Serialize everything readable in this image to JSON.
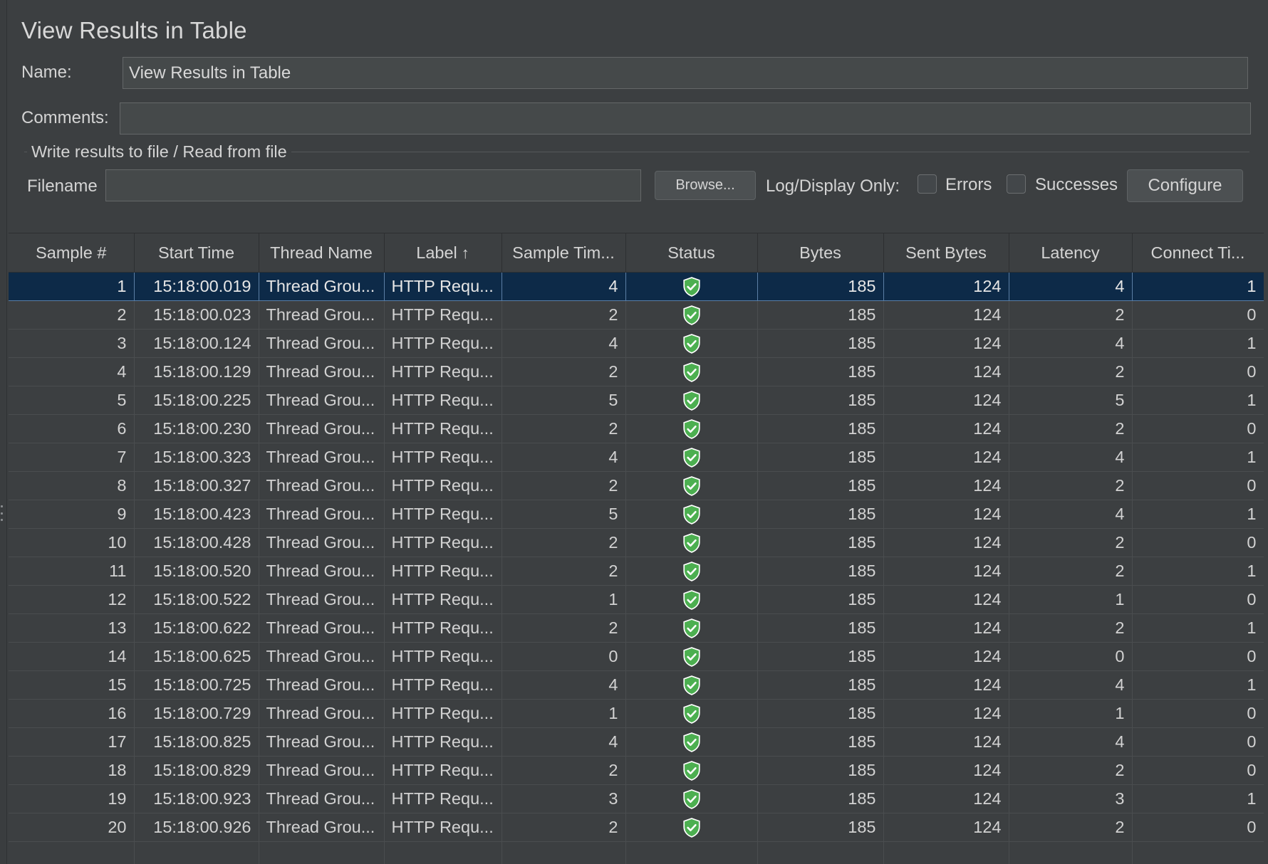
{
  "panel": {
    "title": "View Results in Table",
    "name_label": "Name:",
    "name_value": "View Results in Table",
    "comments_label": "Comments:",
    "comments_value": ""
  },
  "file_section": {
    "title": "Write results to file / Read from file",
    "filename_label": "Filename",
    "filename_value": "",
    "browse_label": "Browse...",
    "log_display_label": "Log/Display Only:",
    "errors_label": "Errors",
    "errors_checked": false,
    "successes_label": "Successes",
    "successes_checked": false,
    "configure_label": "Configure"
  },
  "table": {
    "columns": [
      "Sample #",
      "Start Time",
      "Thread Name",
      "Label",
      "Sample Tim...",
      "Status",
      "Bytes",
      "Sent Bytes",
      "Latency",
      "Connect Ti..."
    ],
    "sort_indicator": "↑",
    "status_icon": "success-shield-icon",
    "colors": {
      "selected_row": "#0d2a48",
      "success": "#4caf50"
    },
    "rows": [
      [
        "1",
        "15:18:00.019",
        "Thread Grou...",
        "HTTP Requ...",
        "4",
        "success",
        "185",
        "124",
        "4",
        "1"
      ],
      [
        "2",
        "15:18:00.023",
        "Thread Grou...",
        "HTTP Requ...",
        "2",
        "success",
        "185",
        "124",
        "2",
        "0"
      ],
      [
        "3",
        "15:18:00.124",
        "Thread Grou...",
        "HTTP Requ...",
        "4",
        "success",
        "185",
        "124",
        "4",
        "1"
      ],
      [
        "4",
        "15:18:00.129",
        "Thread Grou...",
        "HTTP Requ...",
        "2",
        "success",
        "185",
        "124",
        "2",
        "0"
      ],
      [
        "5",
        "15:18:00.225",
        "Thread Grou...",
        "HTTP Requ...",
        "5",
        "success",
        "185",
        "124",
        "5",
        "1"
      ],
      [
        "6",
        "15:18:00.230",
        "Thread Grou...",
        "HTTP Requ...",
        "2",
        "success",
        "185",
        "124",
        "2",
        "0"
      ],
      [
        "7",
        "15:18:00.323",
        "Thread Grou...",
        "HTTP Requ...",
        "4",
        "success",
        "185",
        "124",
        "4",
        "1"
      ],
      [
        "8",
        "15:18:00.327",
        "Thread Grou...",
        "HTTP Requ...",
        "2",
        "success",
        "185",
        "124",
        "2",
        "0"
      ],
      [
        "9",
        "15:18:00.423",
        "Thread Grou...",
        "HTTP Requ...",
        "5",
        "success",
        "185",
        "124",
        "4",
        "1"
      ],
      [
        "10",
        "15:18:00.428",
        "Thread Grou...",
        "HTTP Requ...",
        "2",
        "success",
        "185",
        "124",
        "2",
        "0"
      ],
      [
        "11",
        "15:18:00.520",
        "Thread Grou...",
        "HTTP Requ...",
        "2",
        "success",
        "185",
        "124",
        "2",
        "1"
      ],
      [
        "12",
        "15:18:00.522",
        "Thread Grou...",
        "HTTP Requ...",
        "1",
        "success",
        "185",
        "124",
        "1",
        "0"
      ],
      [
        "13",
        "15:18:00.622",
        "Thread Grou...",
        "HTTP Requ...",
        "2",
        "success",
        "185",
        "124",
        "2",
        "1"
      ],
      [
        "14",
        "15:18:00.625",
        "Thread Grou...",
        "HTTP Requ...",
        "0",
        "success",
        "185",
        "124",
        "0",
        "0"
      ],
      [
        "15",
        "15:18:00.725",
        "Thread Grou...",
        "HTTP Requ...",
        "4",
        "success",
        "185",
        "124",
        "4",
        "1"
      ],
      [
        "16",
        "15:18:00.729",
        "Thread Grou...",
        "HTTP Requ...",
        "1",
        "success",
        "185",
        "124",
        "1",
        "0"
      ],
      [
        "17",
        "15:18:00.825",
        "Thread Grou...",
        "HTTP Requ...",
        "4",
        "success",
        "185",
        "124",
        "4",
        "0"
      ],
      [
        "18",
        "15:18:00.829",
        "Thread Grou...",
        "HTTP Requ...",
        "2",
        "success",
        "185",
        "124",
        "2",
        "0"
      ],
      [
        "19",
        "15:18:00.923",
        "Thread Grou...",
        "HTTP Requ...",
        "3",
        "success",
        "185",
        "124",
        "3",
        "1"
      ],
      [
        "20",
        "15:18:00.926",
        "Thread Grou...",
        "HTTP Requ...",
        "2",
        "success",
        "185",
        "124",
        "2",
        "0"
      ]
    ],
    "selected_row_index": 0
  }
}
